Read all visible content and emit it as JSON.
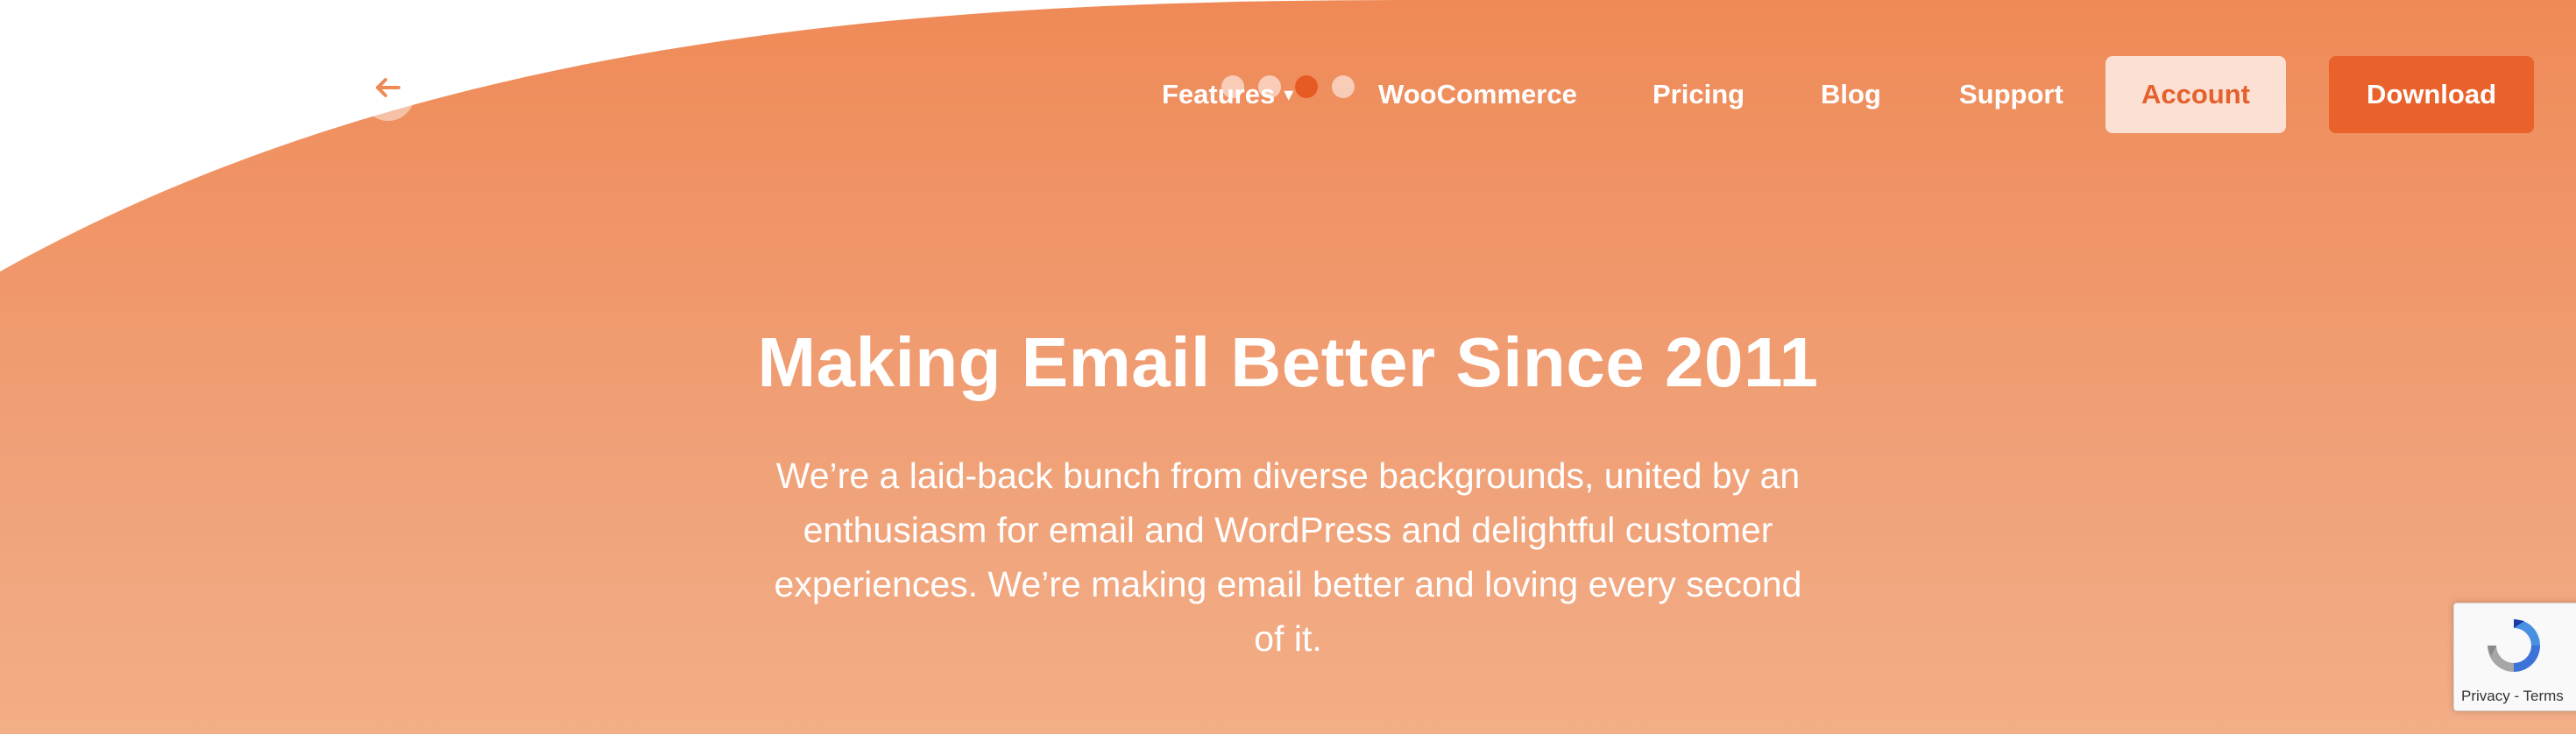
{
  "colors": {
    "accent": "#e9612b",
    "hero_top": "#ef8a57",
    "hero_bottom": "#f2ae87",
    "account_bg": "#fbe0d3"
  },
  "slider": {
    "back_icon": "arrow-left-icon",
    "dot_count": 4,
    "active_dot": 3
  },
  "nav": {
    "features": "Features",
    "features_caret": "▾",
    "woocommerce": "WooCommerce",
    "pricing": "Pricing",
    "blog": "Blog",
    "support": "Support",
    "account": "Account",
    "download": "Download"
  },
  "hero": {
    "headline": "Making Email Better Since 2011",
    "subtext": "We’re a laid-back bunch from diverse backgrounds, united by an enthusiasm for email and WordPress and delightful customer experiences. We’re making email better and loving every second of it."
  },
  "recaptcha": {
    "icon": "recaptcha-icon",
    "label": "Privacy - Terms"
  }
}
